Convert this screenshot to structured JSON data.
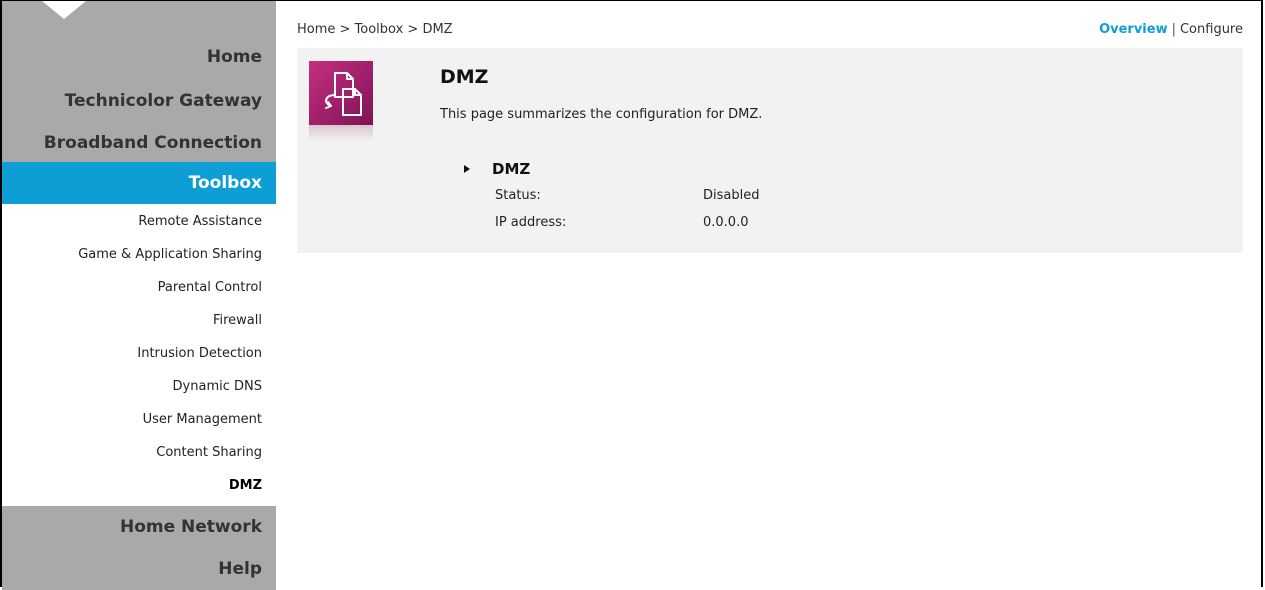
{
  "sidebar": {
    "main_items": [
      {
        "label": "Home"
      },
      {
        "label": "Technicolor Gateway"
      },
      {
        "label": "Broadband Connection"
      },
      {
        "label": "Toolbox"
      },
      {
        "label": "Home Network"
      },
      {
        "label": "Help"
      }
    ],
    "sub_items": [
      {
        "label": "Remote Assistance"
      },
      {
        "label": "Game & Application Sharing"
      },
      {
        "label": "Parental Control"
      },
      {
        "label": "Firewall"
      },
      {
        "label": "Intrusion Detection"
      },
      {
        "label": "Dynamic DNS"
      },
      {
        "label": "User Management"
      },
      {
        "label": "Content Sharing"
      },
      {
        "label": "DMZ"
      }
    ],
    "active_item": "Toolbox",
    "current_sub_item": "DMZ"
  },
  "breadcrumb": "Home > Toolbox > DMZ",
  "topnav": {
    "overview": "Overview",
    "separator": "|",
    "configure": "Configure"
  },
  "page": {
    "icon": "dmz-documents-icon",
    "title": "DMZ",
    "description": "This page summarizes the configuration for DMZ.",
    "section": {
      "title": "DMZ",
      "rows": [
        {
          "label": "Status:",
          "value": "Disabled"
        },
        {
          "label": "IP address:",
          "value": "0.0.0.0"
        }
      ]
    }
  },
  "colors": {
    "accent": "#0e9ed6",
    "sidebar_bg": "#a9a9a9",
    "panel_bg": "#f2f2f2",
    "tile": "#b0236f"
  }
}
